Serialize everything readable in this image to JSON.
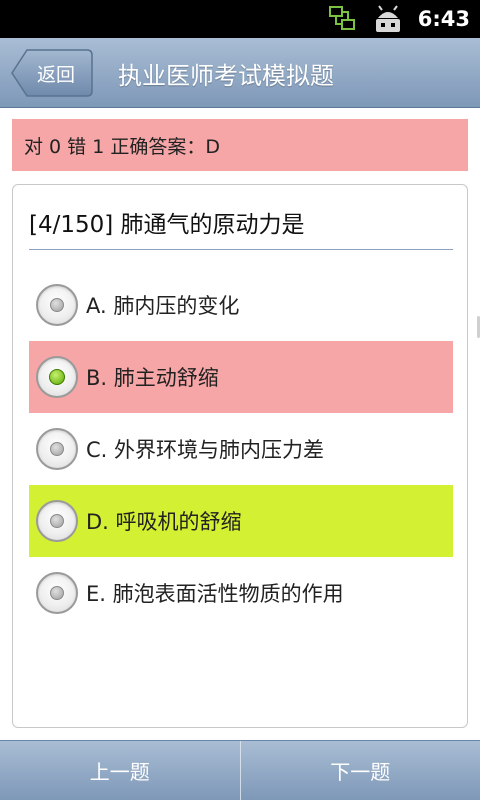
{
  "status_bar": {
    "time": "6:43",
    "icons": [
      "network-sync-icon",
      "android-debug-icon"
    ]
  },
  "title_bar": {
    "back_label": "返回",
    "title": "执业医师考试模拟题"
  },
  "result": {
    "text": "对 0 错 1  正确答案：D"
  },
  "question": {
    "text": "[4/150] 肺通气的原动力是",
    "options": [
      {
        "label": "A. 肺内压的变化",
        "state": "normal",
        "checked": false
      },
      {
        "label": "B. 肺主动舒缩",
        "state": "wrong",
        "checked": true
      },
      {
        "label": "C. 外界环境与肺内压力差",
        "state": "normal",
        "checked": false
      },
      {
        "label": "D. 呼吸机的舒缩",
        "state": "correct",
        "checked": false
      },
      {
        "label": "E. 肺泡表面活性物质的作用",
        "state": "normal",
        "checked": false
      }
    ]
  },
  "nav": {
    "prev_label": "上一题",
    "next_label": "下一题"
  },
  "colors": {
    "wrong_highlight": "#f6a6a6",
    "correct_highlight": "#d3f032",
    "bar_blue": "#7e98b8"
  }
}
